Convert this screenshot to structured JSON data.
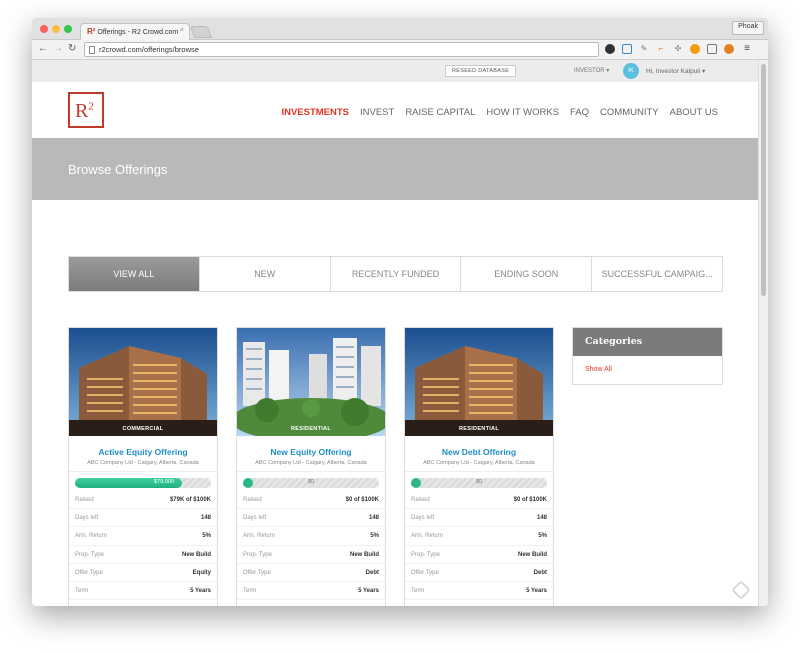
{
  "browser": {
    "tab_title": "Offerings - R2 Crowd.com",
    "tab_logo": "R²",
    "tab_close": "×",
    "profile_name": "Phoak",
    "url": "r2crowd.com/offerings/browse",
    "icons": [
      "back-icon",
      "forward-icon",
      "reload-icon",
      "page-icon"
    ]
  },
  "utility_bar": {
    "reseed_label": "RESEED DATABASE",
    "investor_label": "INVESTOR ▾",
    "avatar_initials": "IK",
    "user_name": "Hi, Investor Kalpuli  ▾"
  },
  "header": {
    "logo_text": "R",
    "logo_sup": "2",
    "nav": [
      "INVESTMENTS",
      "INVEST",
      "RAISE CAPITAL",
      "HOW IT WORKS",
      "FAQ",
      "COMMUNITY",
      "ABOUT US"
    ],
    "active_nav": "INVESTMENTS"
  },
  "banner": {
    "title": "Browse Offerings"
  },
  "filters": [
    "VIEW ALL",
    "NEW",
    "RECENTLY FUNDED",
    "ENDING SOON",
    "SUCCESSFUL CAMPAIG..."
  ],
  "cards": [
    {
      "tag": "COMMERCIAL",
      "title": "Active Equity Offering",
      "subtitle": "ABC Company Ltd - Calgary, Alberta, Canada",
      "progress_label": "$79,000",
      "progress_fraction": 0.79,
      "rows": [
        {
          "k": "Raised",
          "v": "$79K of $100K"
        },
        {
          "k": "Days left",
          "v": "148"
        },
        {
          "k": "Ann. Return",
          "v": "5%"
        },
        {
          "k": "Prop. Type",
          "v": "New Build"
        },
        {
          "k": "Offer Type",
          "v": "Equity"
        },
        {
          "k": "Term",
          "v": "5 Years"
        }
      ]
    },
    {
      "tag": "RESIDENTIAL",
      "title": "New Equity Offering",
      "subtitle": "ABC Company Ltd - Calgary, Alberta, Canada",
      "progress_label": "$0",
      "progress_fraction": 0,
      "rows": [
        {
          "k": "Raised",
          "v": "$0 of $100K"
        },
        {
          "k": "Days left",
          "v": "148"
        },
        {
          "k": "Ann. Return",
          "v": "5%"
        },
        {
          "k": "Prop. Type",
          "v": "New Build"
        },
        {
          "k": "Offer Type",
          "v": "Debt"
        },
        {
          "k": "Term",
          "v": "5 Years"
        }
      ]
    },
    {
      "tag": "RESIDENTIAL",
      "title": "New Debt Offering",
      "subtitle": "ABC Company Ltd - Calgary, Alberta, Canada",
      "progress_label": "$0",
      "progress_fraction": 0,
      "rows": [
        {
          "k": "Raised",
          "v": "$0 of $100K"
        },
        {
          "k": "Days left",
          "v": "148"
        },
        {
          "k": "Ann. Return",
          "v": "5%"
        },
        {
          "k": "Prop. Type",
          "v": "New Build"
        },
        {
          "k": "Offer Type",
          "v": "Debt"
        },
        {
          "k": "Term",
          "v": "5 Years"
        }
      ]
    }
  ],
  "categories": {
    "title": "Categories",
    "link": "Show All"
  },
  "colors": {
    "accent": "#e03527",
    "link_blue": "#1f8fc7",
    "progress_green": "#2ab88a",
    "banner_gray": "#b9b9b9"
  }
}
